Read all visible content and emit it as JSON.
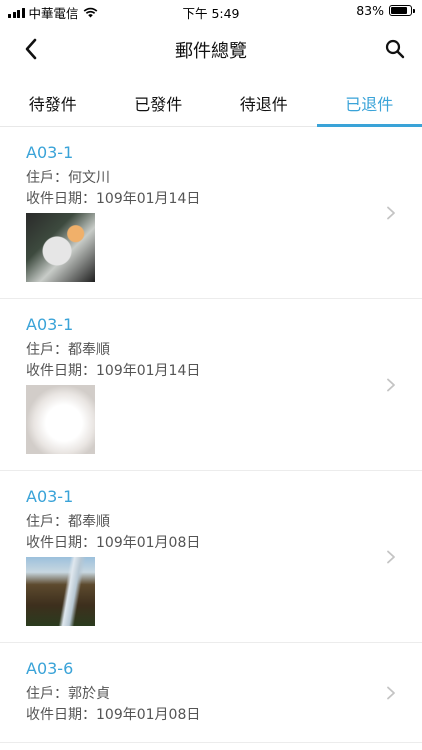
{
  "status": {
    "carrier": "中華電信",
    "time": "下午 5:49",
    "battery": "83%",
    "battery_level": 0.83
  },
  "nav": {
    "title": "郵件總覽",
    "back_icon": "chevron-left-icon",
    "search_icon": "search-icon"
  },
  "tabs": [
    {
      "label": "待發件",
      "active": false
    },
    {
      "label": "已發件",
      "active": false
    },
    {
      "label": "待退件",
      "active": false
    },
    {
      "label": "已退件",
      "active": true
    }
  ],
  "items": [
    {
      "code": "A03-1",
      "resident": "住戶：何文川",
      "date": "收件日期：109年01月14日",
      "has_photo": true
    },
    {
      "code": "A03-1",
      "resident": "住戶：都奉順",
      "date": "收件日期：109年01月14日",
      "has_photo": true
    },
    {
      "code": "A03-1",
      "resident": "住戶：都奉順",
      "date": "收件日期：109年01月08日",
      "has_photo": true
    },
    {
      "code": "A03-6",
      "resident": "住戶：郭於貞",
      "date": "收件日期：109年01月08日",
      "has_photo": false
    }
  ],
  "colors": {
    "accent": "#3aa3d8",
    "divider": "#ececec"
  }
}
